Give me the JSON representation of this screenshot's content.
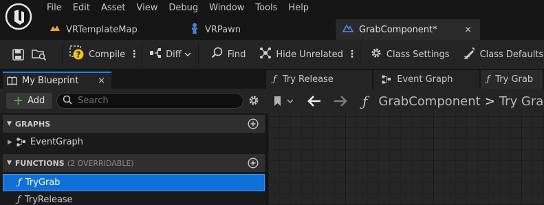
{
  "menu": [
    "File",
    "Edit",
    "Asset",
    "View",
    "Debug",
    "Window",
    "Tools",
    "Help"
  ],
  "tabs": {
    "map": "VRTemplateMap",
    "pawn": "VRPawn",
    "grab": "GrabComponent*",
    "close": "×"
  },
  "toolbar": {
    "compile": "Compile",
    "diff": "Diff",
    "find": "Find",
    "hide_unrelated": "Hide Unrelated",
    "class_settings": "Class Settings",
    "class_defaults": "Class Defaults",
    "dots": "⋮"
  },
  "my_blueprint": {
    "tab_label": "My Blueprint",
    "close": "×",
    "add_label": "Add",
    "search_placeholder": "Search",
    "graphs_header": "GRAPHS",
    "event_graph": "EventGraph",
    "functions_header": "FUNCTIONS",
    "functions_sub": "(2 OVERRIDABLE)",
    "functions": [
      "TryGrab",
      "TryRelease"
    ]
  },
  "graph": {
    "tab_release": "Try Release",
    "tab_event": "Event Graph",
    "tab_trygrab": "Try Grab",
    "crumb_component": "GrabComponent",
    "crumb_sep": ">",
    "crumb_function": "Try Grab"
  },
  "colors": {
    "accent": "#0f70d7",
    "add_green": "#4fc23c",
    "compile_warning": "#f5c518",
    "pawn_icon": "#4a7fd8"
  },
  "icons": {
    "logo": "unreal-logo",
    "map": "level-icon",
    "pawn": "pawn-icon",
    "blueprint": "blueprint-icon",
    "save": "save-icon",
    "browse": "browse-icon",
    "compile": "compile-warning-icon",
    "diff": "diff-icon",
    "find": "find-icon",
    "hide": "hide-unrelated-icon",
    "settings": "gear-icon",
    "defaults": "class-defaults-icon"
  }
}
